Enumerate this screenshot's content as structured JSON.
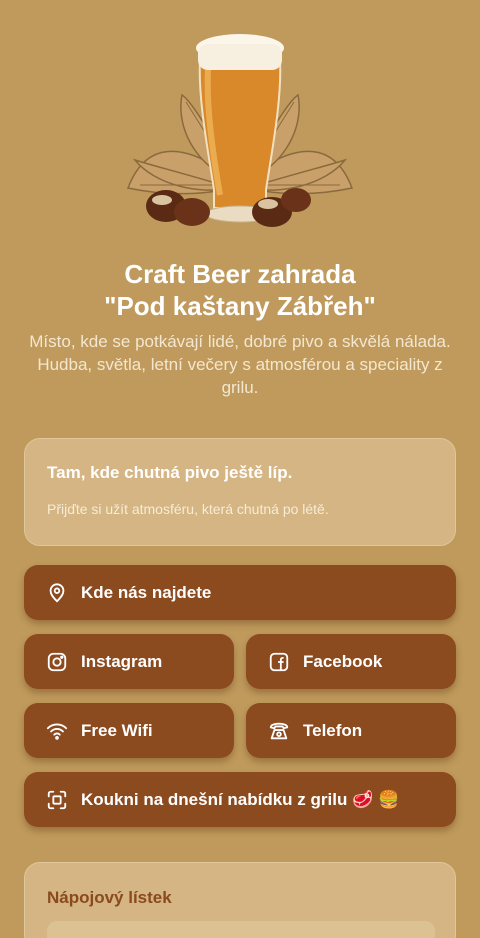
{
  "header": {
    "title_line1": "Craft Beer zahrada",
    "title_line2": "\"Pod kaštany Zábřeh\"",
    "description": "Místo, kde se potkávají lidé, dobré pivo a skvělá nálada. Hudba, světla, letní večery s atmosférou a speciality z grilu."
  },
  "intro_card": {
    "title": "Tam, kde chutná pivo ještě líp.",
    "text": "Přijďte si užít atmosféru, která chutná po létě."
  },
  "links": {
    "map": {
      "label": "Kde nás najdete",
      "icon": "location-pin-icon"
    },
    "instagram": {
      "label": "Instagram",
      "icon": "instagram-icon"
    },
    "facebook": {
      "label": "Facebook",
      "icon": "facebook-icon"
    },
    "wifi": {
      "label": "Free Wifi",
      "icon": "wifi-icon"
    },
    "phone": {
      "label": "Telefon",
      "icon": "phone-icon"
    },
    "grill": {
      "label": "Koukni na dnešní nabídku z grilu 🥩 🍔",
      "icon": "qr-scan-icon"
    }
  },
  "menu_card": {
    "title": "Nápojový lístek"
  },
  "colors": {
    "background": "#bf9a5c",
    "button": "#8c4a1f",
    "card": "#d4b583",
    "menu_title": "#8a4a1e"
  }
}
